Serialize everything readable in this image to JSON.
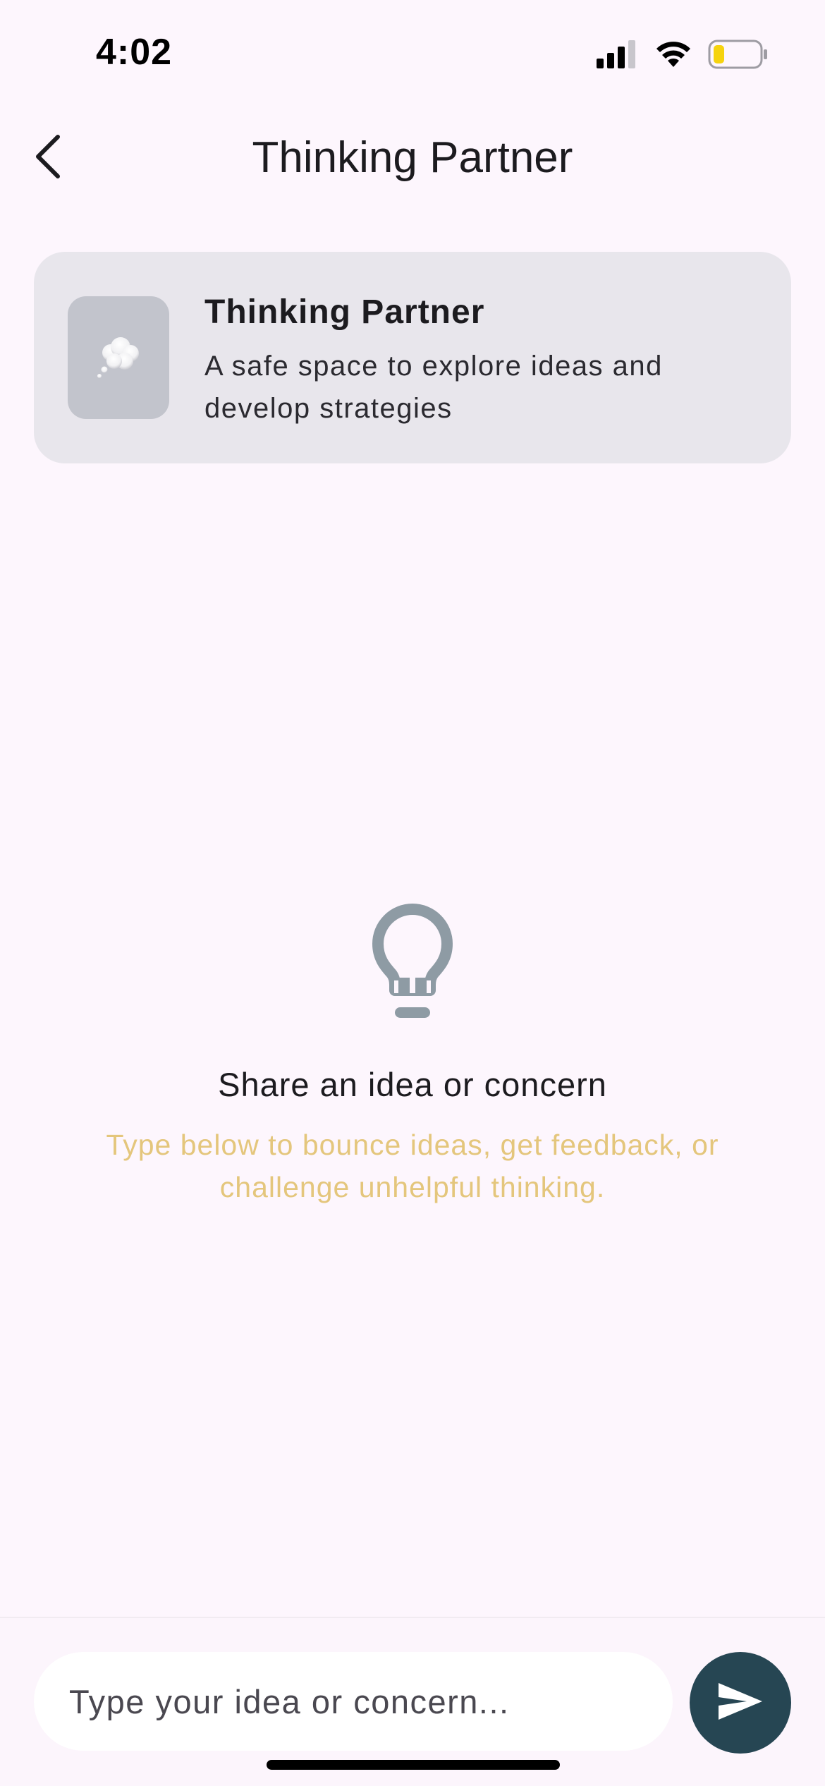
{
  "status_bar": {
    "time": "4:02",
    "icons": [
      "cellular-signal-icon",
      "wifi-icon",
      "battery-icon"
    ],
    "battery_color": "#f5d30f"
  },
  "header": {
    "title": "Thinking Partner",
    "back_icon": "chevron-left-icon"
  },
  "intro_card": {
    "icon": "thought-bubble-icon",
    "title": "Thinking Partner",
    "description": "A safe space to explore ideas and develop strategies"
  },
  "empty_state": {
    "icon": "lightbulb-icon",
    "title": "Share an idea or concern",
    "subtitle": "Type below to bounce ideas, get feedback, or challenge unhelpful thinking."
  },
  "composer": {
    "value": "",
    "placeholder": "Type your idea or concern...",
    "send_icon": "send-icon"
  },
  "colors": {
    "background": "#fdf6fd",
    "accent": "#264653",
    "subtitle": "#e4c67c",
    "card": "#e8e6ec"
  }
}
